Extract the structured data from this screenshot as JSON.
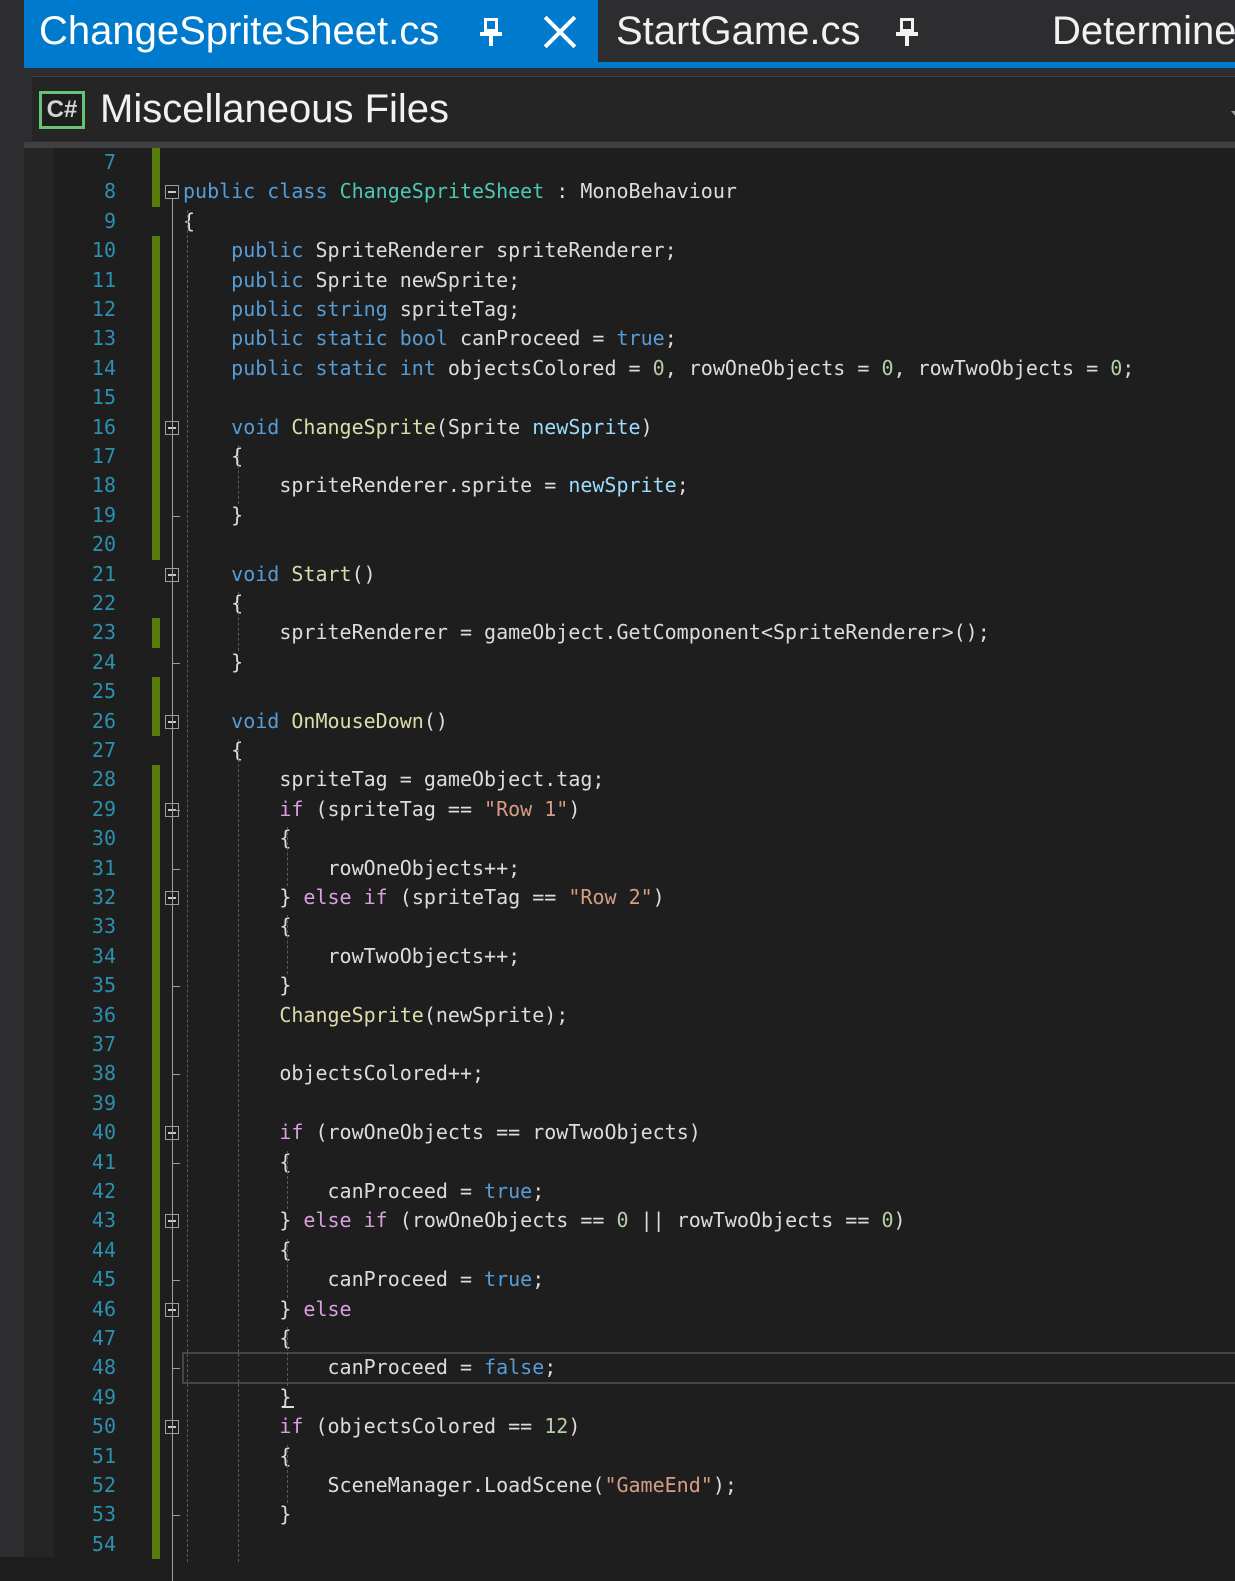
{
  "tabs": [
    {
      "label": "ChangeSpriteSheet.cs",
      "active": true,
      "pinned": true,
      "closable": true
    },
    {
      "label": "StartGame.cs",
      "active": false,
      "pinned": true
    },
    {
      "label": "DetermineY",
      "active": false
    }
  ],
  "navbar": {
    "language_icon": "C#",
    "project": "Miscellaneous Files"
  },
  "colors": {
    "accent": "#007acc",
    "background": "#1e1e1e",
    "line_number": "#2b91af",
    "change_marker": "#587c0c",
    "keyword": "#569cd6",
    "control": "#d8a0df",
    "type": "#4ec9b0",
    "method": "#dcdcaa",
    "parameter": "#9cdcfe",
    "string": "#d69d85",
    "number": "#b5cea8",
    "text": "#dcdcdc"
  },
  "editor": {
    "lines": [
      {
        "n": "7",
        "tokens": [],
        "changed": true
      },
      {
        "n": "8",
        "tokens": [
          [
            "kw",
            "public"
          ],
          [
            "",
            " "
          ],
          [
            "kw",
            "class"
          ],
          [
            "",
            " "
          ],
          [
            "ty",
            "ChangeSpriteSheet"
          ],
          [
            "",
            " : MonoBehaviour"
          ]
        ],
        "changed": true,
        "fold": true
      },
      {
        "n": "9",
        "tokens": [
          [
            "",
            "{"
          ]
        ],
        "changed": false
      },
      {
        "n": "10",
        "tokens": [
          [
            "",
            "    "
          ],
          [
            "kw",
            "public"
          ],
          [
            "",
            " SpriteRenderer spriteRenderer;"
          ]
        ],
        "changed": true
      },
      {
        "n": "11",
        "tokens": [
          [
            "",
            "    "
          ],
          [
            "kw",
            "public"
          ],
          [
            "",
            " Sprite newSprite;"
          ]
        ],
        "changed": true
      },
      {
        "n": "12",
        "tokens": [
          [
            "",
            "    "
          ],
          [
            "kw",
            "public"
          ],
          [
            "",
            " "
          ],
          [
            "kw",
            "string"
          ],
          [
            "",
            " spriteTag;"
          ]
        ],
        "changed": true
      },
      {
        "n": "13",
        "tokens": [
          [
            "",
            "    "
          ],
          [
            "kw",
            "public"
          ],
          [
            "",
            " "
          ],
          [
            "kw",
            "static"
          ],
          [
            "",
            " "
          ],
          [
            "kw",
            "bool"
          ],
          [
            "",
            " canProceed = "
          ],
          [
            "kw",
            "true"
          ],
          [
            "",
            ";"
          ]
        ],
        "changed": true
      },
      {
        "n": "14",
        "tokens": [
          [
            "",
            "    "
          ],
          [
            "kw",
            "public"
          ],
          [
            "",
            " "
          ],
          [
            "kw",
            "static"
          ],
          [
            "",
            " "
          ],
          [
            "kw",
            "int"
          ],
          [
            "",
            " objectsColored = "
          ],
          [
            "nm",
            "0"
          ],
          [
            "",
            ", rowOneObjects = "
          ],
          [
            "nm",
            "0"
          ],
          [
            "",
            ", rowTwoObjects = "
          ],
          [
            "nm",
            "0"
          ],
          [
            "",
            ";"
          ]
        ],
        "changed": true
      },
      {
        "n": "15",
        "tokens": [],
        "changed": true
      },
      {
        "n": "16",
        "tokens": [
          [
            "",
            "    "
          ],
          [
            "kw",
            "void"
          ],
          [
            "",
            " "
          ],
          [
            "fn",
            "ChangeSprite"
          ],
          [
            "",
            "(Sprite "
          ],
          [
            "pm",
            "newSprite"
          ],
          [
            "",
            ")"
          ]
        ],
        "changed": true,
        "fold": true
      },
      {
        "n": "17",
        "tokens": [
          [
            "",
            "    {"
          ]
        ],
        "changed": true
      },
      {
        "n": "18",
        "tokens": [
          [
            "",
            "        spriteRenderer.sprite = "
          ],
          [
            "pm",
            "newSprite"
          ],
          [
            "",
            ";"
          ]
        ],
        "changed": true
      },
      {
        "n": "19",
        "tokens": [
          [
            "",
            "    }"
          ]
        ],
        "changed": true
      },
      {
        "n": "20",
        "tokens": [],
        "changed": true
      },
      {
        "n": "21",
        "tokens": [
          [
            "",
            "    "
          ],
          [
            "kw",
            "void"
          ],
          [
            "",
            " "
          ],
          [
            "fn",
            "Start"
          ],
          [
            "",
            "()"
          ]
        ],
        "changed": false,
        "fold": true
      },
      {
        "n": "22",
        "tokens": [
          [
            "",
            "    {"
          ]
        ],
        "changed": false
      },
      {
        "n": "23",
        "tokens": [
          [
            "",
            "        spriteRenderer = gameObject.GetComponent<SpriteRenderer>();"
          ]
        ],
        "changed": true
      },
      {
        "n": "24",
        "tokens": [
          [
            "",
            "    }"
          ]
        ],
        "changed": false
      },
      {
        "n": "25",
        "tokens": [],
        "changed": true
      },
      {
        "n": "26",
        "tokens": [
          [
            "",
            "    "
          ],
          [
            "kw",
            "void"
          ],
          [
            "",
            " "
          ],
          [
            "fn",
            "OnMouseDown"
          ],
          [
            "",
            "()"
          ]
        ],
        "changed": true,
        "fold": true
      },
      {
        "n": "27",
        "tokens": [
          [
            "",
            "    {"
          ]
        ],
        "changed": false
      },
      {
        "n": "28",
        "tokens": [
          [
            "",
            "        spriteTag = gameObject.tag;"
          ]
        ],
        "changed": true
      },
      {
        "n": "29",
        "tokens": [
          [
            "",
            "        "
          ],
          [
            "ctl",
            "if"
          ],
          [
            "",
            " (spriteTag == "
          ],
          [
            "st",
            "\"Row 1\""
          ],
          [
            "",
            ")"
          ]
        ],
        "changed": true,
        "fold": true
      },
      {
        "n": "30",
        "tokens": [
          [
            "",
            "        {"
          ]
        ],
        "changed": true
      },
      {
        "n": "31",
        "tokens": [
          [
            "",
            "            rowOneObjects++;"
          ]
        ],
        "changed": true
      },
      {
        "n": "32",
        "tokens": [
          [
            "",
            "        } "
          ],
          [
            "ctl",
            "else"
          ],
          [
            "",
            " "
          ],
          [
            "ctl",
            "if"
          ],
          [
            "",
            " (spriteTag == "
          ],
          [
            "st",
            "\"Row 2\""
          ],
          [
            "",
            ")"
          ]
        ],
        "changed": true,
        "fold": true
      },
      {
        "n": "33",
        "tokens": [
          [
            "",
            "        {"
          ]
        ],
        "changed": true
      },
      {
        "n": "34",
        "tokens": [
          [
            "",
            "            rowTwoObjects++;"
          ]
        ],
        "changed": true
      },
      {
        "n": "35",
        "tokens": [
          [
            "",
            "        }"
          ]
        ],
        "changed": true
      },
      {
        "n": "36",
        "tokens": [
          [
            "",
            "        "
          ],
          [
            "fn",
            "ChangeSprite"
          ],
          [
            "",
            "(newSprite);"
          ]
        ],
        "changed": true
      },
      {
        "n": "37",
        "tokens": [],
        "changed": true
      },
      {
        "n": "38",
        "tokens": [
          [
            "",
            "        objectsColored++;"
          ]
        ],
        "changed": true
      },
      {
        "n": "39",
        "tokens": [],
        "changed": true
      },
      {
        "n": "40",
        "tokens": [
          [
            "",
            "        "
          ],
          [
            "ctl",
            "if"
          ],
          [
            "",
            " (rowOneObjects == rowTwoObjects)"
          ]
        ],
        "changed": true,
        "fold": true
      },
      {
        "n": "41",
        "tokens": [
          [
            "",
            "        {"
          ]
        ],
        "changed": true
      },
      {
        "n": "42",
        "tokens": [
          [
            "",
            "            canProceed = "
          ],
          [
            "kw",
            "true"
          ],
          [
            "",
            ";"
          ]
        ],
        "changed": true
      },
      {
        "n": "43",
        "tokens": [
          [
            "",
            "        } "
          ],
          [
            "ctl",
            "else"
          ],
          [
            "",
            " "
          ],
          [
            "ctl",
            "if"
          ],
          [
            "",
            " (rowOneObjects == "
          ],
          [
            "nm",
            "0"
          ],
          [
            "",
            " || rowTwoObjects == "
          ],
          [
            "nm",
            "0"
          ],
          [
            "",
            ")"
          ]
        ],
        "changed": true,
        "fold": true
      },
      {
        "n": "44",
        "tokens": [
          [
            "",
            "        {"
          ]
        ],
        "changed": true
      },
      {
        "n": "45",
        "tokens": [
          [
            "",
            "            canProceed = "
          ],
          [
            "kw",
            "true"
          ],
          [
            "",
            ";"
          ]
        ],
        "changed": true
      },
      {
        "n": "46",
        "tokens": [
          [
            "",
            "        } "
          ],
          [
            "ctl",
            "else"
          ]
        ],
        "changed": true,
        "fold": true
      },
      {
        "n": "47",
        "tokens": [
          [
            "",
            "        {"
          ]
        ],
        "changed": true
      },
      {
        "n": "48",
        "tokens": [
          [
            "",
            "            canProceed = "
          ],
          [
            "kw",
            "false"
          ],
          [
            "",
            ";"
          ]
        ],
        "changed": true
      },
      {
        "n": "49",
        "tokens": [
          [
            "",
            "        }"
          ]
        ],
        "changed": true
      },
      {
        "n": "50",
        "tokens": [
          [
            "",
            "        "
          ],
          [
            "ctl",
            "if"
          ],
          [
            "",
            " (objectsColored == "
          ],
          [
            "nm",
            "12"
          ],
          [
            "",
            ")"
          ]
        ],
        "changed": true,
        "fold": true
      },
      {
        "n": "51",
        "tokens": [
          [
            "",
            "        {"
          ]
        ],
        "changed": true
      },
      {
        "n": "52",
        "tokens": [
          [
            "",
            "            SceneManager.LoadScene("
          ],
          [
            "st",
            "\"GameEnd\""
          ],
          [
            "",
            ");"
          ]
        ],
        "changed": true
      },
      {
        "n": "53",
        "tokens": [
          [
            "",
            "        }"
          ]
        ],
        "changed": true
      },
      {
        "n": "54",
        "tokens": [],
        "changed": true
      }
    ]
  }
}
